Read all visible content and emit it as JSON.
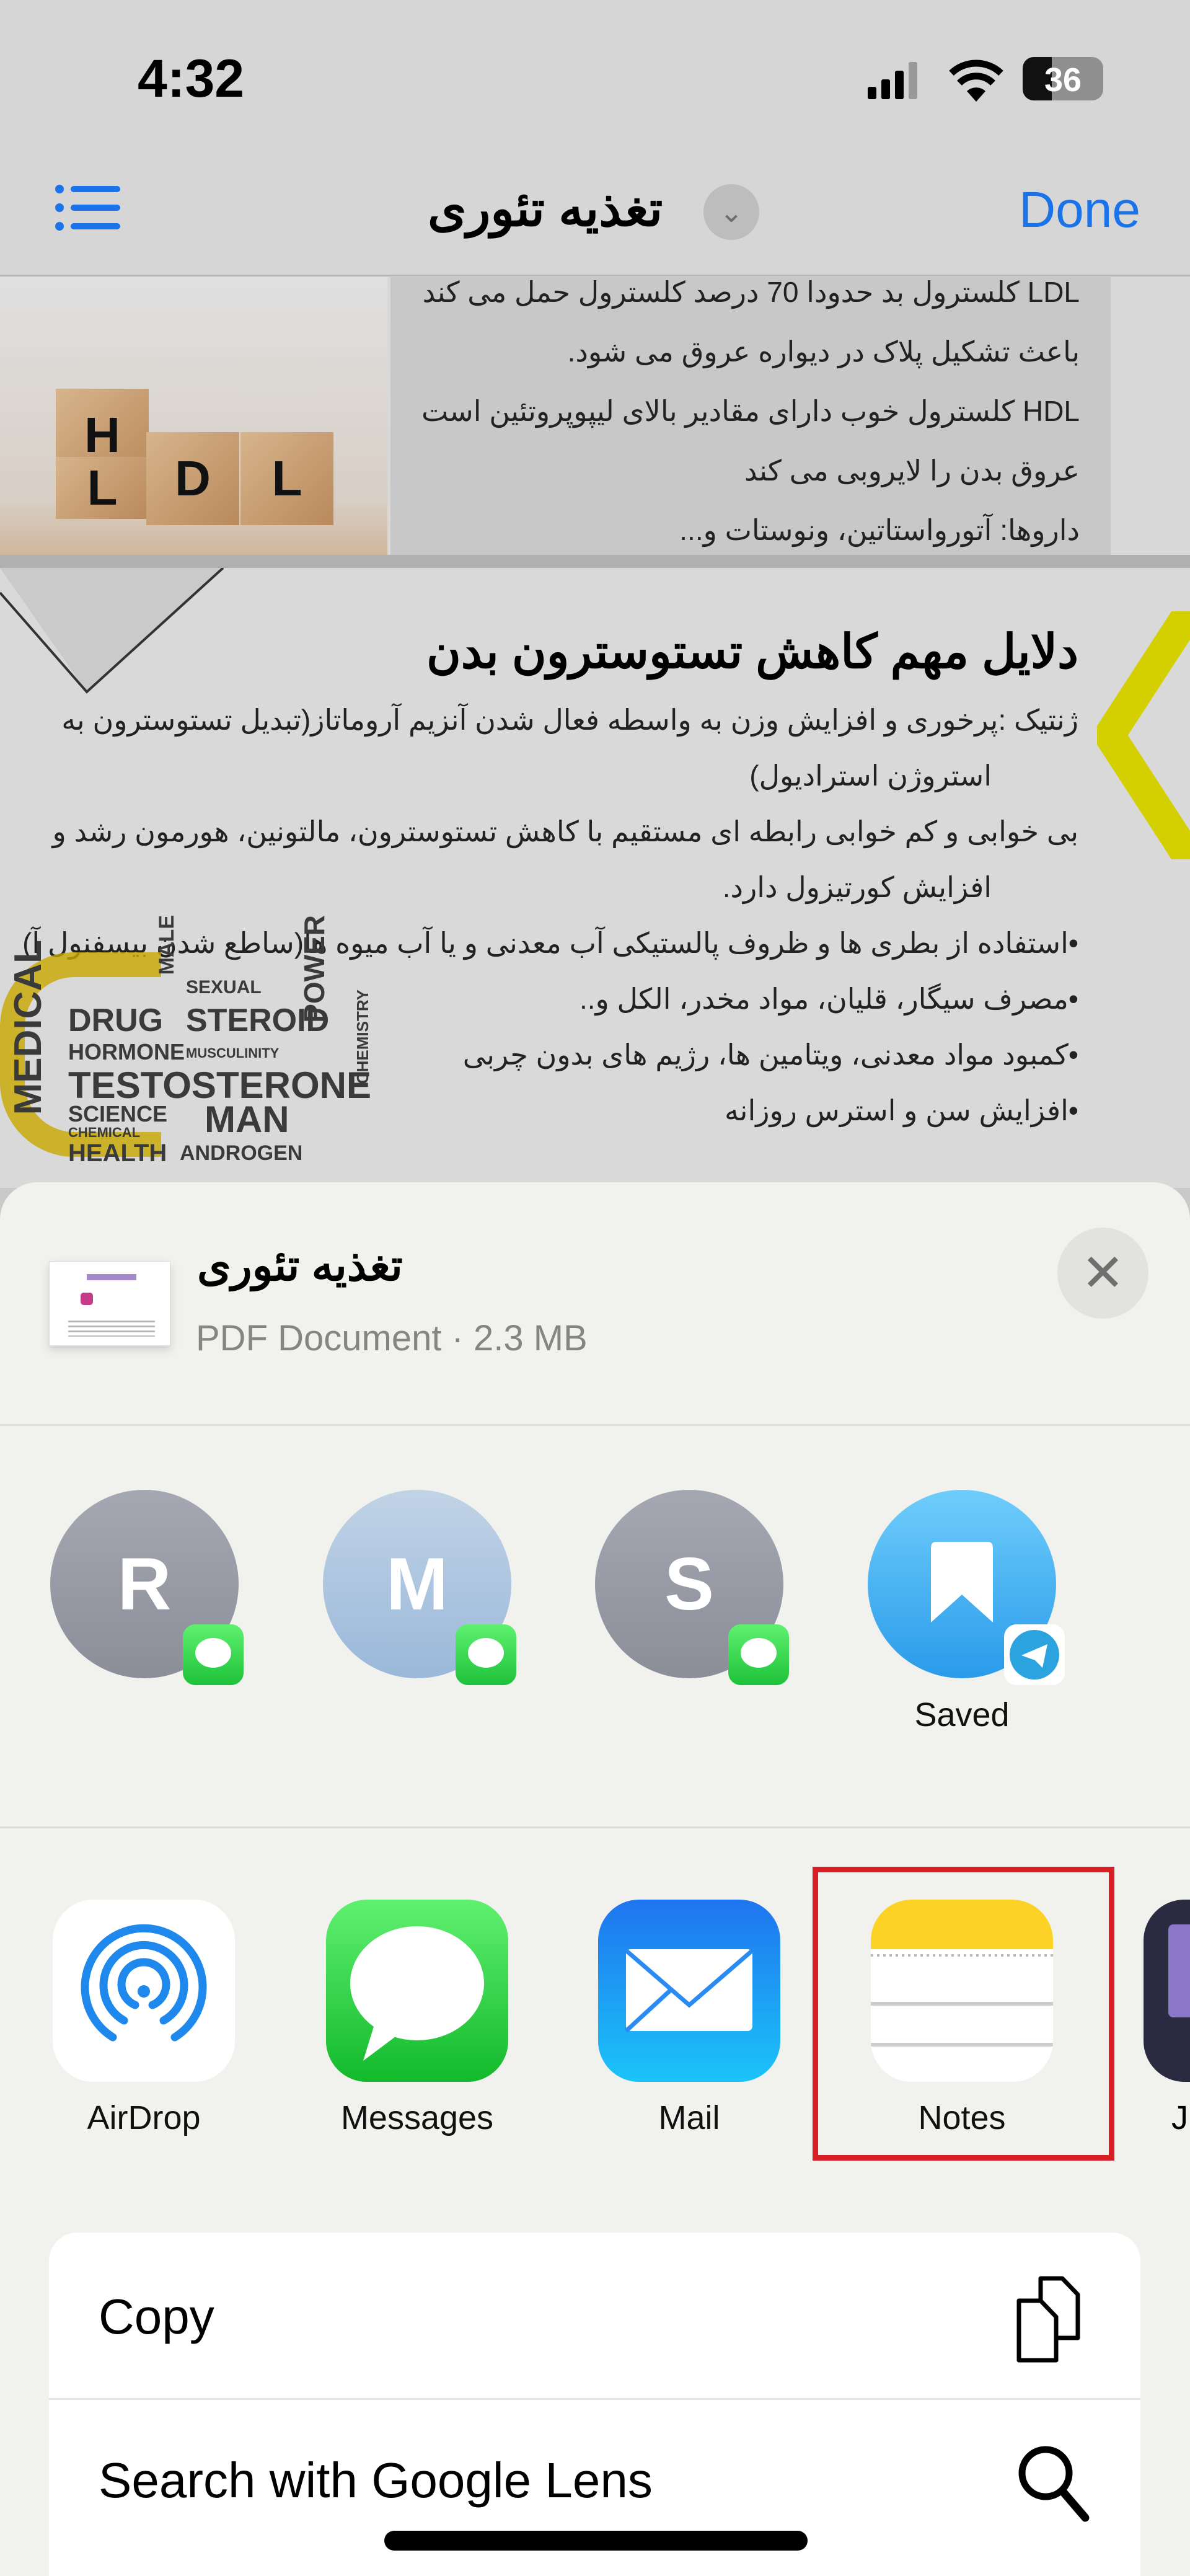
{
  "status_bar": {
    "time": "4:32",
    "battery": "36",
    "battery_level": 36,
    "icons": [
      "signal-icon",
      "wifi-icon",
      "battery-icon"
    ]
  },
  "nav": {
    "title": "تغذیه تئوری",
    "done_label": "Done",
    "icons": [
      "list-icon",
      "chevron-down-icon"
    ],
    "accent": "#1a73e8"
  },
  "pdf": {
    "page1": {
      "cubes": [
        "H",
        "L",
        "D",
        "L"
      ],
      "lines": [
        "LDL کلسترول بد  حدودا 70 درصد کلسترول حمل می کند",
        "باعث تشکیل پلاک در دیواره عروق می شود.",
        "HDL کلسترول خوب دارای مقادیر بالای لیپوپروتئین است",
        "عروق بدن را لایروبی می کند",
        "داروها: آتورواستاتین، ونوستات و..."
      ]
    },
    "page2": {
      "title": "دلایل مهم کاهش تستوسترون بدن",
      "lines": [
        "ژنتیک :پرخوری و افزایش وزن به واسطه فعال شدن آنزیم آروماتاز(تبدیل تستوسترون به",
        "استروژن استرادیول)",
        "بی خوابی و کم خوابی رابطه ای مستقیم با کاهش تستوسترون، مالتونین، هورمون رشد و",
        "افزایش کورتیزول دارد.",
        "•استفاده از بطری ها و ظروف پالستیکی آب معدنی و یا آب میوه ها(ساطع شدن بیسفنول آ)",
        "•مصرف سیگار، قلیان، مواد مخدر، الکل و..",
        "•کمبود مواد معدنی، ویتامین ها، رژیم های بدون چربی",
        "•افزایش سن و استرس روزانه"
      ],
      "wordcloud": [
        "MEDICAL",
        "DRUG",
        "MALE",
        "SEXUAL",
        "STEROID",
        "HORMONE",
        "MUSCULINITY",
        "POWER",
        "TESTOSTERONE",
        "SCIENCE",
        "MAN",
        "CHEMICAL",
        "HEALTH",
        "ANDROGEN",
        "CHEMISTRY"
      ],
      "accent": "#d4cf00"
    }
  },
  "share_sheet": {
    "title": "تغذیه تئوری",
    "subtitle": "PDF Document · 2.3 MB",
    "close_icon": "close-icon",
    "people": [
      {
        "initial": "R",
        "label": "",
        "badge": "messages-badge-icon"
      },
      {
        "initial": "M",
        "label": "",
        "badge": "messages-badge-icon"
      },
      {
        "initial": "S",
        "label": "",
        "badge": "messages-badge-icon"
      },
      {
        "initial": "",
        "label": "Saved",
        "badge": "telegram-badge-icon"
      }
    ],
    "apps": [
      {
        "label": "AirDrop",
        "icon": "airdrop-icon"
      },
      {
        "label": "Messages",
        "icon": "messages-icon"
      },
      {
        "label": "Mail",
        "icon": "mail-icon"
      },
      {
        "label": "Notes",
        "icon": "notes-icon",
        "highlighted": true
      },
      {
        "label": "J",
        "icon": "app-icon"
      }
    ],
    "actions": [
      {
        "label": "Copy",
        "icon": "copy-icon"
      },
      {
        "label": "Search with Google Lens",
        "icon": "search-icon"
      }
    ],
    "highlight_color": "#d81f26"
  }
}
